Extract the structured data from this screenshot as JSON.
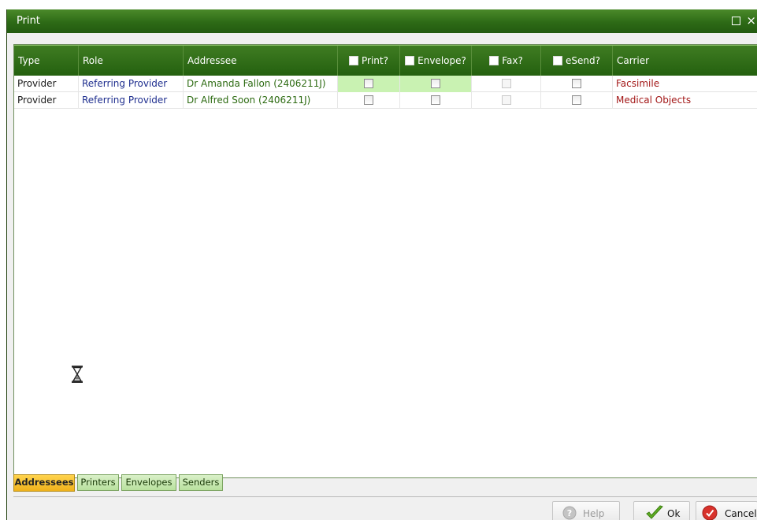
{
  "window": {
    "title": "Print",
    "maximize_symbol": "☐",
    "close_symbol": "×"
  },
  "grid": {
    "columns": [
      {
        "label": "Type"
      },
      {
        "label": "Role"
      },
      {
        "label": "Addressee"
      },
      {
        "label": "Print?",
        "has_checkbox": true
      },
      {
        "label": "Envelope?",
        "has_checkbox": true
      },
      {
        "label": "Fax?",
        "has_checkbox": true
      },
      {
        "label": "eSend?",
        "has_checkbox": true
      },
      {
        "label": "Carrier"
      }
    ],
    "rows": [
      {
        "type": "Provider",
        "role": "Referring Provider",
        "addressee": "Dr  Amanda Fallon (2406211J)",
        "print": false,
        "envelope": false,
        "fax": false,
        "fax_enabled": false,
        "esend": false,
        "carrier": "Facsimile"
      },
      {
        "type": "Provider",
        "role": "Referring Provider",
        "addressee": "Dr Alfred Soon (2406211J)",
        "print": false,
        "envelope": false,
        "fax": false,
        "fax_enabled": false,
        "esend": false,
        "carrier": "Medical Objects"
      }
    ]
  },
  "tabs": [
    {
      "label": "Addressees",
      "active": true
    },
    {
      "label": "Printers",
      "active": false
    },
    {
      "label": "Envelopes",
      "active": false
    },
    {
      "label": "Senders",
      "active": false
    }
  ],
  "buttons": {
    "help": {
      "label": "Help",
      "enabled": false,
      "icon": "help-icon"
    },
    "ok": {
      "label": "Ok",
      "enabled": true,
      "icon": "checkmark-icon"
    },
    "cancel": {
      "label": "Cancel",
      "enabled": true,
      "icon": "cancel-icon"
    }
  },
  "colors": {
    "title_bar": "#2d6a16",
    "header": "#24600f",
    "highlight_cell": "#c9f2b2",
    "role_text": "#1f2f8f",
    "addressee_text": "#2d6b12",
    "carrier_text": "#a31818",
    "active_tab": "#f0b21b"
  }
}
